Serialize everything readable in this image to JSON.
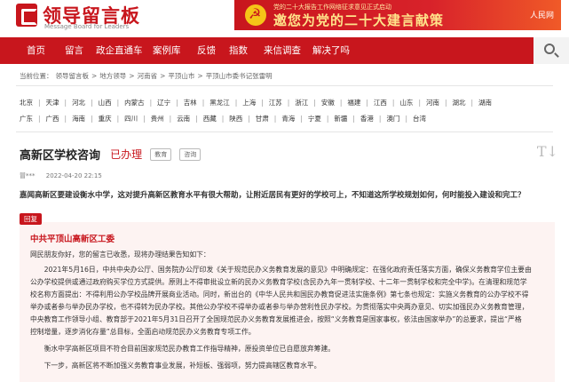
{
  "header": {
    "logo_cn": "领导留言板",
    "logo_en": "Message Board for Leaders",
    "banner_top": "党的二十大报告工作网络征求意见正式启动",
    "banner_main": "邀您为党的二十大建言献策",
    "banner_logo": "人民网"
  },
  "nav": {
    "items": [
      "首页",
      "留言",
      "政企直通车",
      "案例库",
      "反馈",
      "指数",
      "来信调查",
      "解决了吗"
    ]
  },
  "breadcrumb": [
    "当前位置：",
    "领导留言板",
    ">",
    "地方领导",
    ">",
    "河南省",
    ">",
    "平顶山市",
    ">",
    "平顶山市委书记张雷明"
  ],
  "regions": {
    "row1": [
      "北京",
      "天津",
      "河北",
      "山西",
      "内蒙古",
      "辽宁",
      "吉林",
      "黑龙江",
      "上海",
      "江苏",
      "浙江",
      "安徽",
      "福建",
      "江西",
      "山东",
      "河南",
      "湖北",
      "湖南"
    ],
    "row2": [
      "广东",
      "广西",
      "海南",
      "重庆",
      "四川",
      "贵州",
      "云南",
      "西藏",
      "陕西",
      "甘肃",
      "青海",
      "宁夏",
      "新疆",
      "香港",
      "澳门",
      "台湾"
    ]
  },
  "message": {
    "title": "高新区学校咨询",
    "status": "已办理",
    "tags": [
      "教育",
      "咨询"
    ],
    "author": "冒***",
    "time": "2022-04-20 22:15",
    "question": "嘉闻高新区要建设衡水中学，这对提升高新区教育水平有很大帮助，让附近居民有更好的学校可上，不知道这所学校规划如何，何时能投入建设和完工？"
  },
  "reply": {
    "badge": "回复",
    "org": "中共平顶山高新区工委",
    "paragraphs": [
      "网民朋友你好，您的留言已收悉，现将办理结果告知如下：",
      "　　2021年5月16日，中共中央办公厅、国务院办公厅印发《关于规范民办义务教育发展的意见》中明确规定：在强化政府责任落实方面，确保义务教育学位主要由",
      "公办学校提供或通过政府购买学位方式提供。原则上不得审批设立新的民办义务教育学校(含民办九年一贯制学校、十二年一贯制学校和完全中学)。在清理和规范学",
      "校名称方面提出：不得利用公办学校品牌开展商业活动。同时，新出台的《中华人民共和国民办教育促进法实施条例》第七条也规定：实施义务教育的公办学校不得",
      "举办或者参与举办民办学校，也不得转为民办学校。其他公办学校不得举办或者参与举办营利性民办学校。为贯彻落实中央两办意见、切实加强民办义务教育管理，",
      "中央教育工作领导小组、教育部于2021年5月31日召开了全国规范民办义务教育发展推进会，按照“义务教育是国家事权，依法由国家举办”的总要求，提出“严格",
      "控制增量，逐步消化存量”总目标，全面启动规范民办义务教育专项工作。",
      "　　衡水中学高新区项目不符合目前国家规范民办教育工作指导精神，原投资单位已自愿放弃筹建。",
      "　　下一步，高新区将不断加强义务教育事业发展，补短板、强弱项，努力提高辖区教育水平。"
    ]
  },
  "colors": {
    "brand": "#c8161d",
    "reply_bg": "#fdf3f2"
  }
}
